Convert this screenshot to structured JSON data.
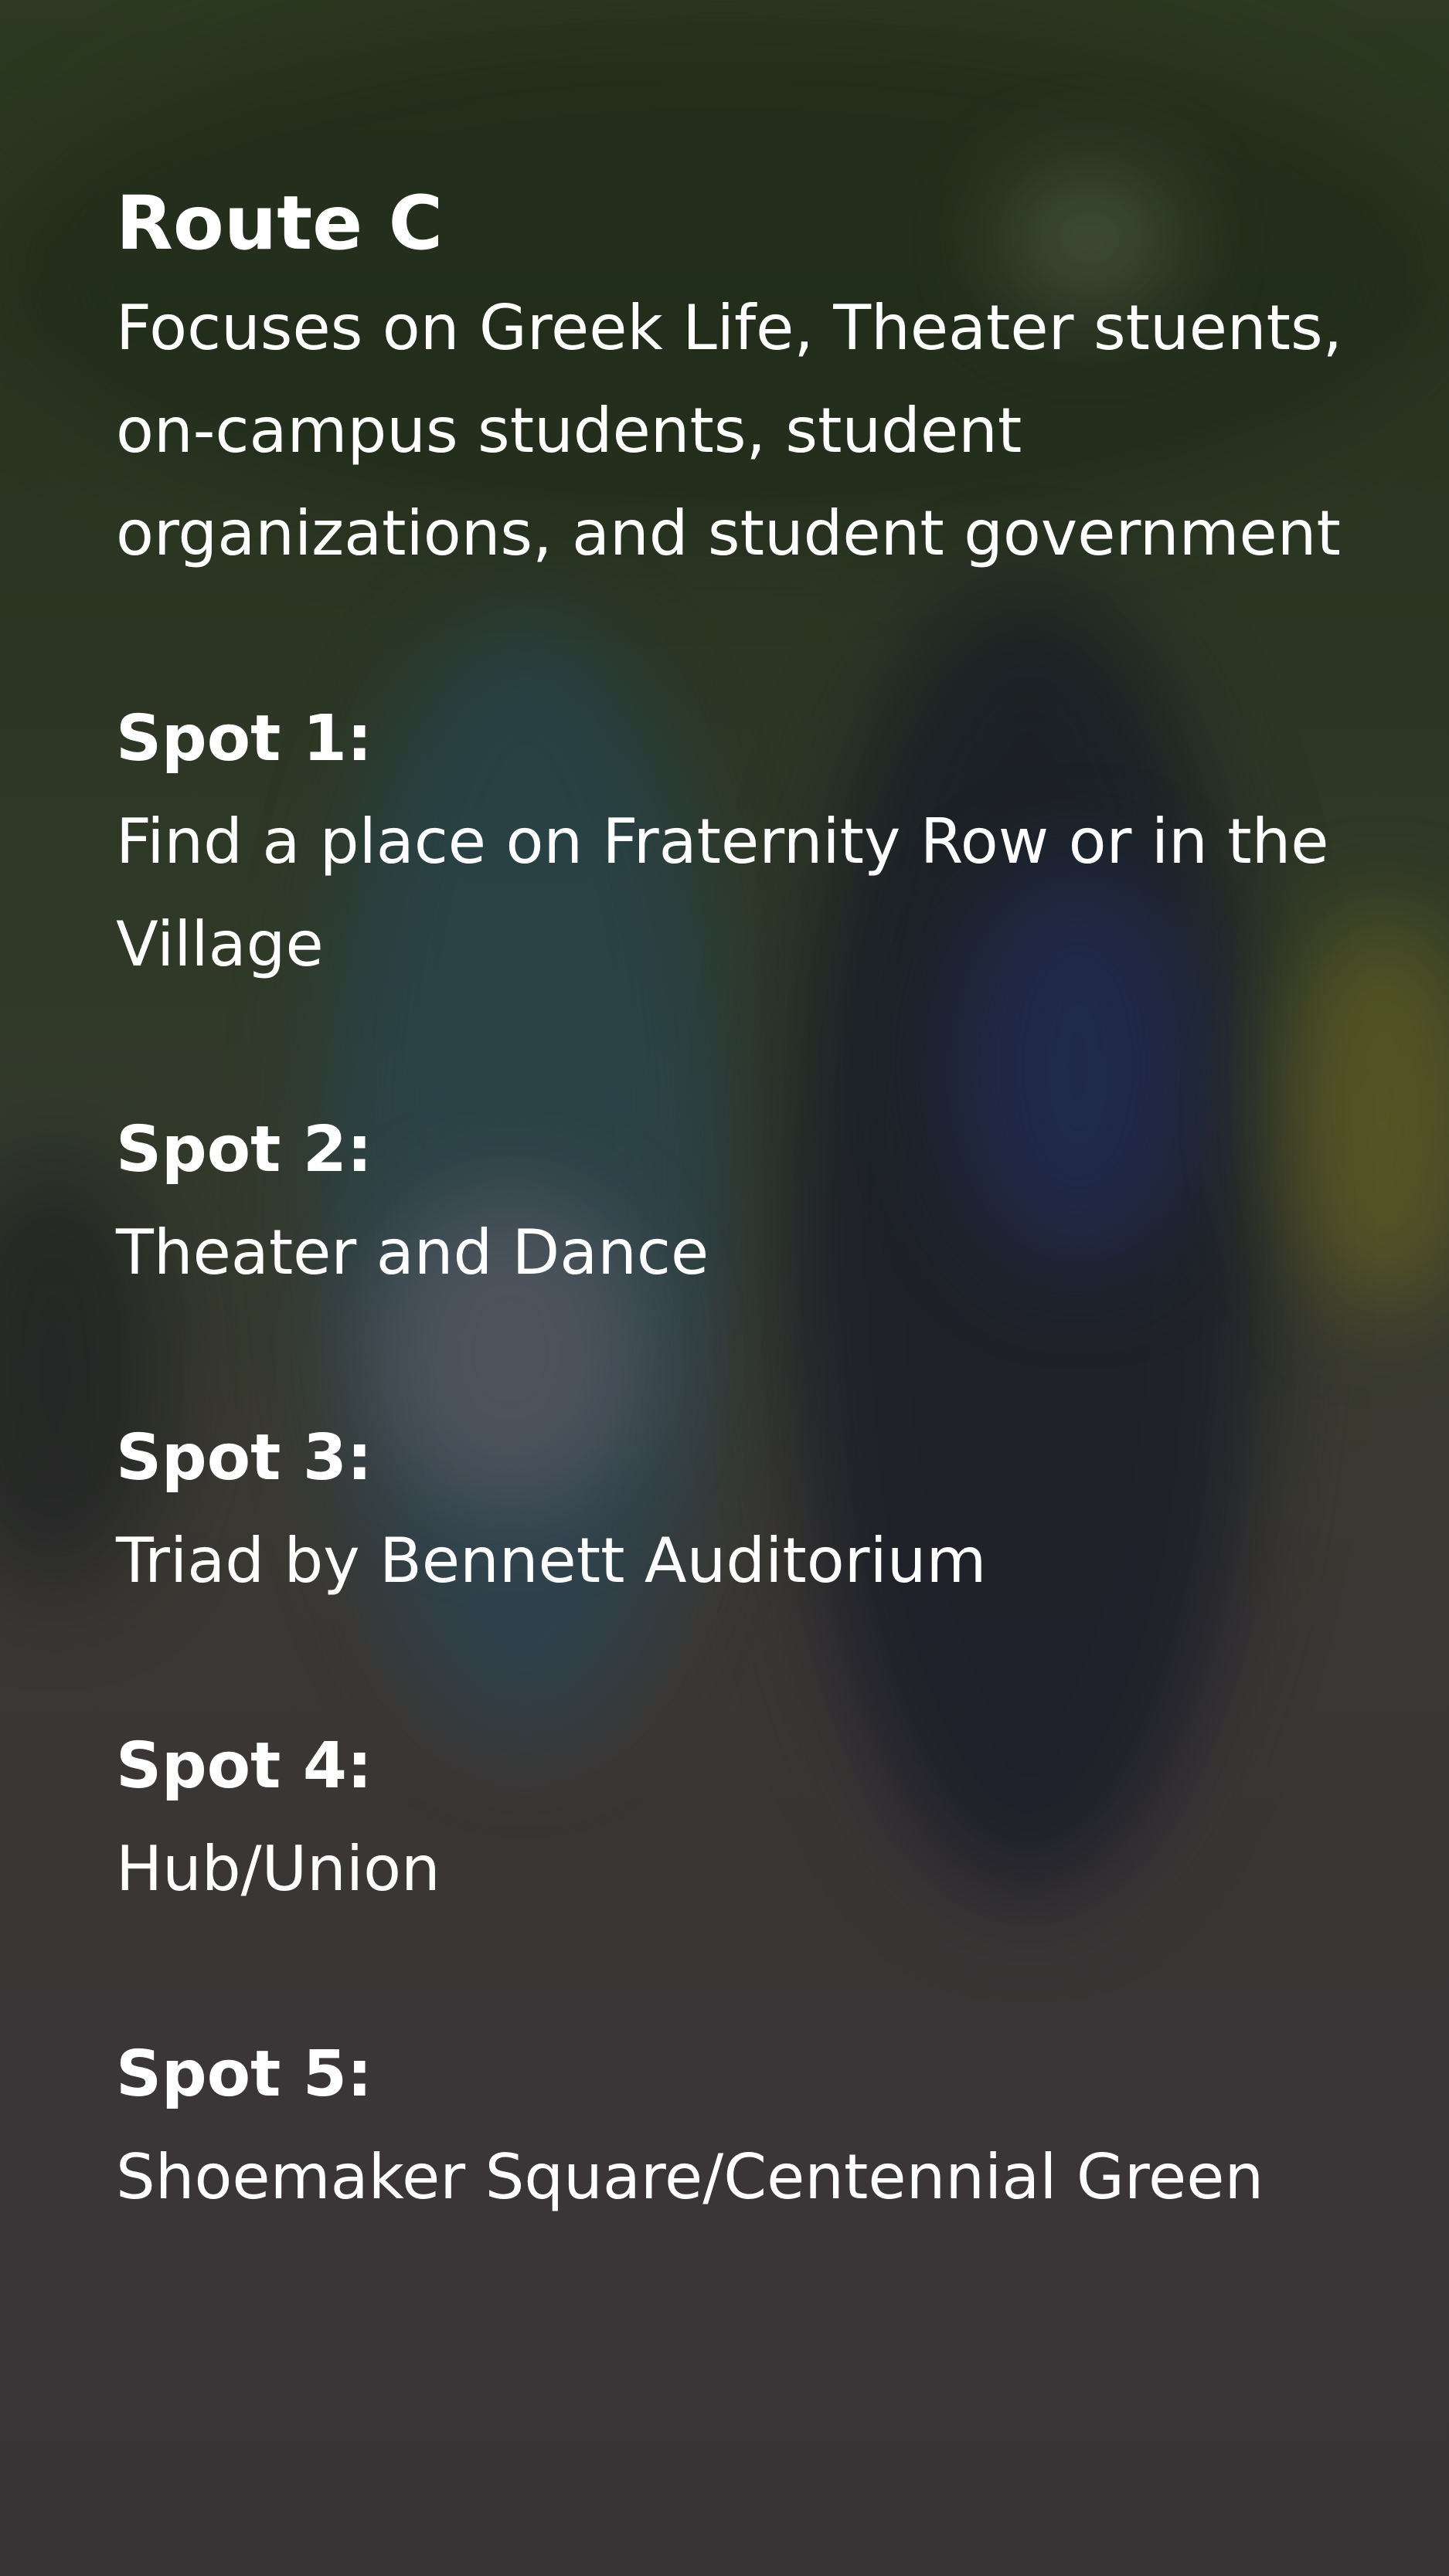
{
  "route": {
    "title": "Route C",
    "description": "Focuses on Greek Life, Theater stuents, on-campus students, student organizations, and student government"
  },
  "spots": [
    {
      "label": "Spot 1:",
      "text": "Find a place on Fraternity Row or in the Village"
    },
    {
      "label": "Spot 2:",
      "text": "Theater and Dance"
    },
    {
      "label": "Spot 3:",
      "text": "Triad by Bennett Auditorium"
    },
    {
      "label": "Spot 4:",
      "text": "Hub/Union"
    },
    {
      "label": "Spot 5:",
      "text": "Shoemaker Square/Centennial Green"
    }
  ]
}
